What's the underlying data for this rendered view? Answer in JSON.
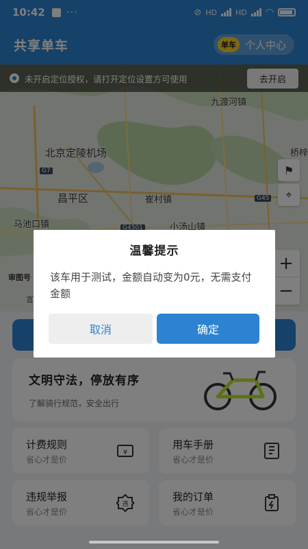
{
  "status_bar": {
    "time": "10:42",
    "dots": "···",
    "net1": "HD",
    "net2": "HD"
  },
  "header": {
    "title": "共享单车",
    "user_logo": "单车",
    "user_center": "个人中心"
  },
  "location_banner": {
    "text": "未开启定位授权，请打开定位设置方可使用",
    "button": "去开启"
  },
  "map": {
    "labels": [
      "九渡河镇",
      "北京定陵机场",
      "昌平区",
      "崔村镇",
      "马池口镇",
      "小汤山镇",
      "桥梓"
    ],
    "roads": [
      "G7",
      "G45",
      "G4501"
    ],
    "partial_labels": [
      "审图号",
      "言"
    ]
  },
  "slogan": {
    "title": "文明守法，停放有序",
    "subtitle": "了解骑行规范，安全出行"
  },
  "tiles": [
    {
      "title": "计费规则",
      "subtitle": "省心才是价",
      "icon": "billing-icon"
    },
    {
      "title": "用车手册",
      "subtitle": "省心才是价",
      "icon": "manual-icon"
    },
    {
      "title": "违规举报",
      "subtitle": "省心才是价",
      "icon": "report-badge-icon"
    },
    {
      "title": "我的订单",
      "subtitle": "省心才是价",
      "icon": "order-clipboard-icon"
    }
  ],
  "dialog": {
    "title": "温馨提示",
    "message": "该车用于测试，金额自动变为0元，无需支付金额",
    "cancel": "取消",
    "confirm": "确定"
  },
  "colors": {
    "accent": "#2c83d1",
    "logo": "#ffd21f",
    "bike_green": "#b8e22e"
  }
}
